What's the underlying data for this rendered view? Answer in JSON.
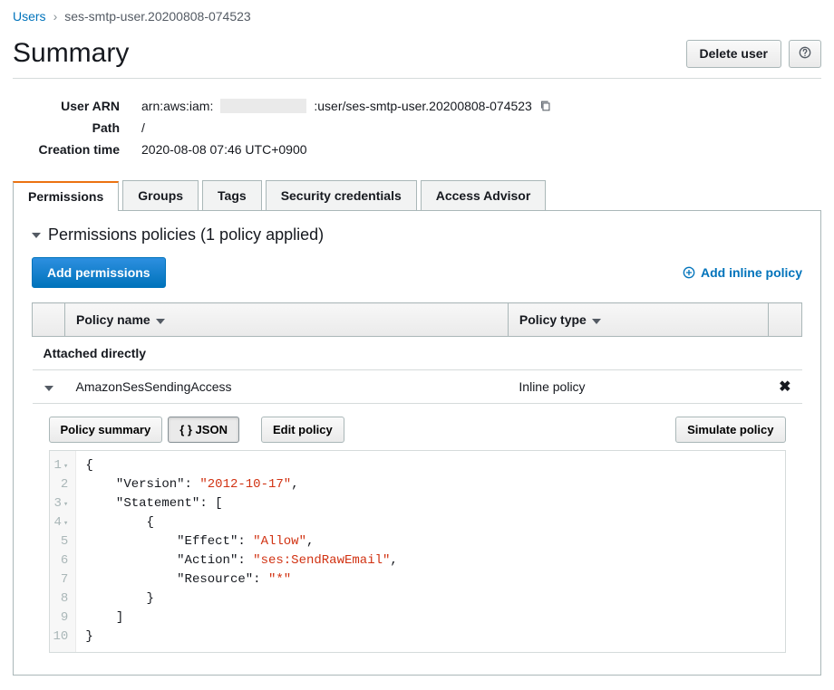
{
  "breadcrumb": {
    "root": "Users",
    "current": "ses-smtp-user.20200808-074523"
  },
  "page_title": "Summary",
  "actions": {
    "delete_user": "Delete user"
  },
  "details": {
    "user_arn_label": "User ARN",
    "user_arn_prefix": "arn:aws:iam:",
    "user_arn_suffix": ":user/ses-smtp-user.20200808-074523",
    "path_label": "Path",
    "path_value": "/",
    "creation_label": "Creation time",
    "creation_value": "2020-08-08 07:46 UTC+0900"
  },
  "tabs": [
    "Permissions",
    "Groups",
    "Tags",
    "Security credentials",
    "Access Advisor"
  ],
  "permissions": {
    "section_title": "Permissions policies (1 policy applied)",
    "add_permissions": "Add permissions",
    "add_inline": "Add inline policy",
    "col_policy_name": "Policy name",
    "col_policy_type": "Policy type",
    "category": "Attached directly",
    "policy_name": "AmazonSesSendingAccess",
    "policy_type": "Inline policy",
    "policy_summary": "Policy summary",
    "json_tab": "{ } JSON",
    "edit_policy": "Edit policy",
    "simulate_policy": "Simulate policy"
  },
  "policy_json": {
    "Version": "2012-10-17",
    "Statement": [
      {
        "Effect": "Allow",
        "Action": "ses:SendRawEmail",
        "Resource": "*"
      }
    ]
  },
  "code_tokens": {
    "version_key": "\"Version\"",
    "version_val": "\"2012-10-17\"",
    "statement_key": "\"Statement\"",
    "effect_key": "\"Effect\"",
    "effect_val": "\"Allow\"",
    "action_key": "\"Action\"",
    "action_val": "\"ses:SendRawEmail\"",
    "resource_key": "\"Resource\"",
    "resource_val": "\"*\""
  }
}
